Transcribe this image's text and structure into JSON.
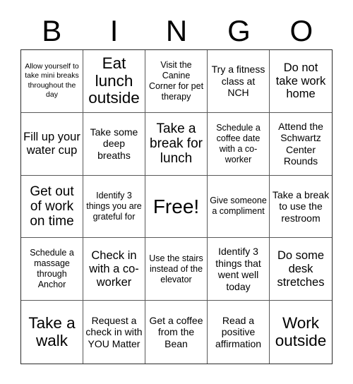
{
  "card": {
    "title_letters": [
      "B",
      "I",
      "N",
      "G",
      "O"
    ],
    "columns": 5,
    "rows": 5,
    "border_color": "#2b2b2b",
    "grid_line_color": "#595959",
    "background_color": "#ffffff",
    "text_color": "#000000",
    "free_space": {
      "row": 3,
      "column": 3,
      "label": "Free!"
    },
    "cells": [
      {
        "text": "Allow yourself to take mini breaks throughout the day",
        "size": "fs-xs"
      },
      {
        "text": "Eat lunch outside",
        "size": "fs-xxl"
      },
      {
        "text": "Visit the Canine Corner for pet therapy",
        "size": "fs-sm"
      },
      {
        "text": "Try a fitness class at NCH",
        "size": "fs-md"
      },
      {
        "text": "Do not take work home",
        "size": "fs-lg"
      },
      {
        "text": "Fill up your water cup",
        "size": "fs-lg"
      },
      {
        "text": "Take some deep breaths",
        "size": "fs-md"
      },
      {
        "text": "Take a break for lunch",
        "size": "fs-xl"
      },
      {
        "text": "Schedule a coffee date with a co-worker",
        "size": "fs-sm"
      },
      {
        "text": "Attend the Schwartz Center Rounds",
        "size": "fs-md"
      },
      {
        "text": "Get out of work on time",
        "size": "fs-xl"
      },
      {
        "text": "Identify 3 things you are grateful for",
        "size": "fs-sm"
      },
      {
        "text": "Free!",
        "size": "fs-free"
      },
      {
        "text": "Give someone a compliment",
        "size": "fs-sm"
      },
      {
        "text": "Take a break to use the restroom",
        "size": "fs-md"
      },
      {
        "text": "Schedule a massage through Anchor",
        "size": "fs-sm"
      },
      {
        "text": "Check in with a co-worker",
        "size": "fs-lg"
      },
      {
        "text": "Use the stairs instead of the elevator",
        "size": "fs-sm"
      },
      {
        "text": "Identify 3 things that went well today",
        "size": "fs-md"
      },
      {
        "text": "Do some desk stretches",
        "size": "fs-lg"
      },
      {
        "text": "Take a walk",
        "size": "fs-xxl"
      },
      {
        "text": "Request a check in with YOU Matter",
        "size": "fs-md"
      },
      {
        "text": "Get a coffee from the Bean",
        "size": "fs-md"
      },
      {
        "text": "Read a positive affirmation",
        "size": "fs-md"
      },
      {
        "text": "Work outside",
        "size": "fs-xxl"
      }
    ]
  }
}
